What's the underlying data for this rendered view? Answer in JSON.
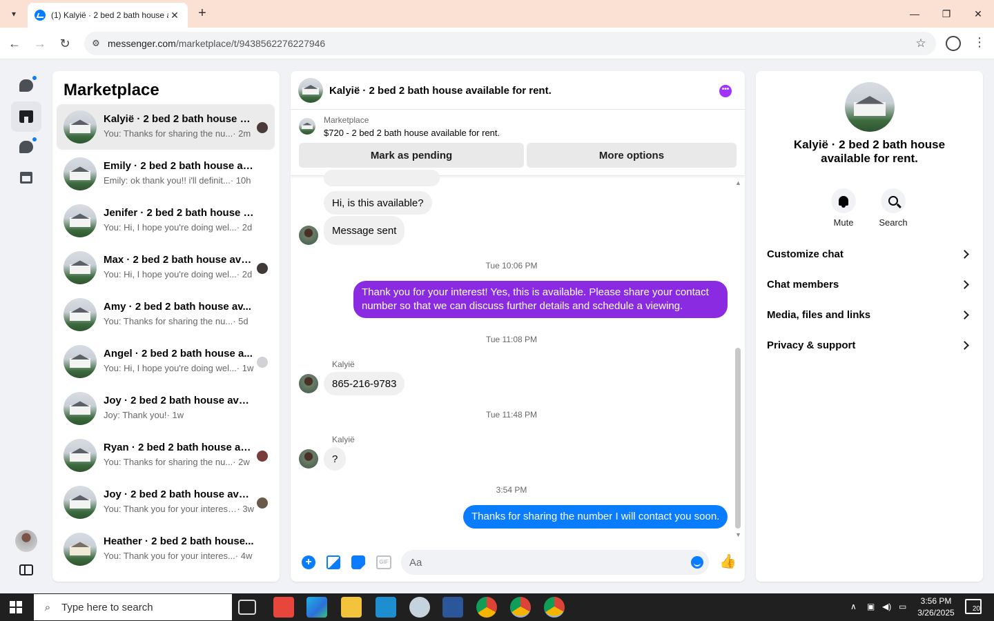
{
  "browser": {
    "tab_title": "(1) Kalyië · 2 bed 2 bath house a",
    "url_host": "messenger.com",
    "url_path": "/marketplace/t/9438562276227946",
    "new_tab": "+",
    "close_tab": "✕"
  },
  "sidebar": {
    "title": "Marketplace",
    "conversations": [
      {
        "name": "Kalyië · 2 bed 2 bath house a...",
        "preview": "You: Thanks for sharing the nu...",
        "time": " · 2m"
      },
      {
        "name": "Emily · 2 bed 2 bath house av...",
        "preview": "Emily: ok thank you!! i'll definit...",
        "time": " · 10h"
      },
      {
        "name": "Jenifer · 2 bed 2 bath house a...",
        "preview": "You: Hi, I hope you're doing wel...",
        "time": " · 2d"
      },
      {
        "name": "Max · 2 bed 2 bath house ava...",
        "preview": "You: Hi, I hope you're doing wel...",
        "time": " · 2d"
      },
      {
        "name": "Amy · 2 bed 2 bath house av...",
        "preview": "You: Thanks for sharing the nu...",
        "time": " · 5d"
      },
      {
        "name": "Angel · 2 bed 2 bath house a...",
        "preview": "You: Hi, I hope you're doing wel...",
        "time": " · 1w"
      },
      {
        "name": "Joy · 2 bed 2 bath house avail...",
        "preview": "Joy: Thank you!",
        "time": " · 1w"
      },
      {
        "name": "Ryan · 2 bed 2 bath house av...",
        "preview": "You: Thanks for sharing the nu...",
        "time": " · 2w"
      },
      {
        "name": "Joy · 2 bed 2 bath house avail...",
        "preview": "You: Thank you for your interest...",
        "time": " · 3w"
      },
      {
        "name": "Heather · 2 bed 2 bath house...",
        "preview": "You: Thank you for your interes...",
        "time": " · 4w"
      }
    ]
  },
  "chat": {
    "title": "Kalyië · 2 bed 2 bath house available for rent.",
    "listing_label": "Marketplace",
    "listing_price": "$720 - 2 bed 2 bath house available for rent.",
    "mark_pending": "Mark as pending",
    "more_options": "More options",
    "messages": {
      "m1": "Hi, is this available?",
      "m2": "Message sent",
      "ts1": "Tue 10:06 PM",
      "m3": "Thank you for your interest! Yes, this is available. Please share your contact number so that we can discuss further details and schedule a viewing.",
      "ts2": "Tue 11:08 PM",
      "sender1": "Kalyië",
      "m4": "865-216-9783",
      "ts3": "Tue 11:48 PM",
      "sender2": "Kalyië",
      "m5": "?",
      "ts4": "3:54 PM",
      "m6": "Thanks for sharing the number I will contact you soon."
    },
    "input_placeholder": "Aa",
    "gif": "GIF"
  },
  "details": {
    "title": "Kalyië · 2 bed 2 bath house available for rent.",
    "mute": "Mute",
    "search": "Search",
    "items": [
      "Customize chat",
      "Chat members",
      "Media, files and links",
      "Privacy & support"
    ]
  },
  "taskbar": {
    "search_placeholder": "Type here to search",
    "time": "3:56 PM",
    "date": "3/26/2025",
    "notifications": "20"
  },
  "colors": {
    "outgoing_purple": "#8a2be2",
    "outgoing_blue": "#0a7cff",
    "accent": "#0a7cff"
  }
}
